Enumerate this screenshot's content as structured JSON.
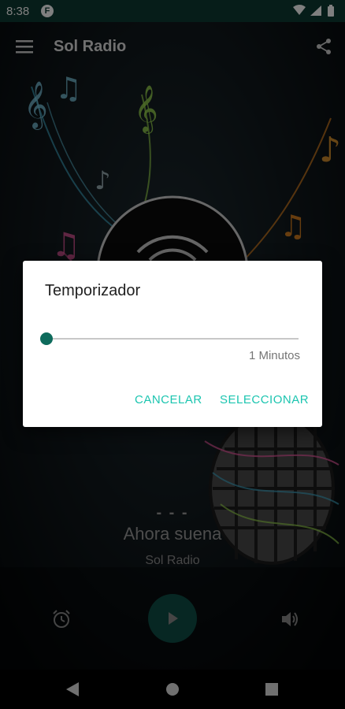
{
  "status_bar": {
    "time": "8:38",
    "app_badge": "F"
  },
  "app_bar": {
    "title": "Sol Radio"
  },
  "now_playing": {
    "dash": "- - -",
    "title": "Ahora suena",
    "station": "Sol Radio"
  },
  "dialog": {
    "title": "Temporizador",
    "slider_value": 1,
    "value_label": "1 Minutos",
    "cancel_label": "CANCELAR",
    "select_label": "SELECCIONAR"
  },
  "colors": {
    "accent": "#1cc5b0",
    "primary_dark": "#0d3b33",
    "play": "#0e4f46"
  },
  "icons": [
    "menu-icon",
    "share-icon",
    "alarm-icon",
    "play-icon",
    "volume-icon",
    "wifi-icon",
    "signal-icon",
    "battery-icon",
    "nav-back-icon",
    "nav-home-icon",
    "nav-recents-icon"
  ]
}
